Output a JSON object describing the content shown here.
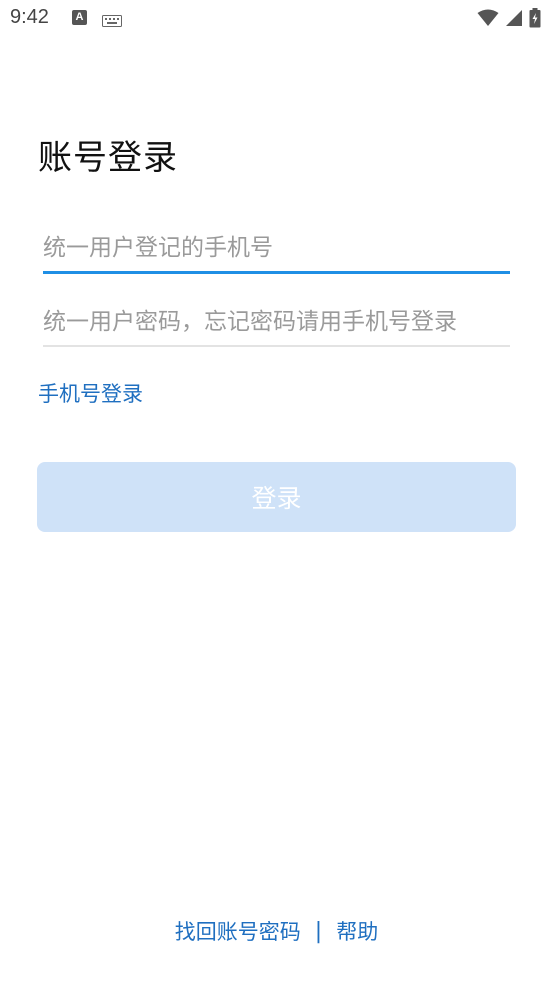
{
  "status_bar": {
    "time": "9:42",
    "notification_icon_letter": "A"
  },
  "login": {
    "title": "账号登录",
    "username_placeholder": "统一用户登记的手机号",
    "password_placeholder": "统一用户密码，忘记密码请用手机号登录",
    "phone_login_link": "手机号登录",
    "submit_label": "登录",
    "submit_enabled": false
  },
  "footer": {
    "recover_account_link": "找回账号密码",
    "separator": "|",
    "help_link": "帮助"
  },
  "colors": {
    "accent": "#1f8fe5",
    "link": "#1f6fc0",
    "button_disabled_bg": "#cfe2f8"
  }
}
